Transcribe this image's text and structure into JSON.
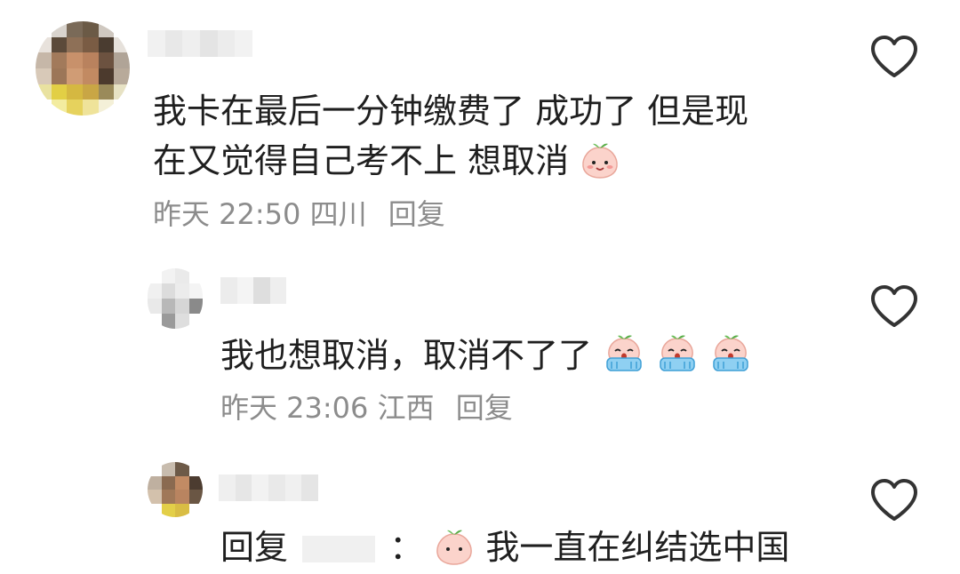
{
  "comments": [
    {
      "lines": [
        "我卡在最后一分钟缴费了 成功了 但是现",
        "在又觉得自己考不上 想取消"
      ],
      "meta": {
        "time": "昨天 22:50",
        "location": "四川",
        "reply": "回复"
      },
      "emoji": "peach-smile"
    },
    {
      "lines": [
        "我也想取消，取消不了了"
      ],
      "meta": {
        "time": "昨天 23:06",
        "location": "江西",
        "reply": "回复"
      },
      "emoji": "peach-cry"
    },
    {
      "lines": [
        "回复",
        "：",
        "我一直在纠结选中国"
      ],
      "emoji": "peach-smile"
    }
  ],
  "colors": {
    "text": "#1f1f1f",
    "meta": "#8c8c8c",
    "heart": "#333333"
  },
  "icons": {
    "like": "heart-outline-icon"
  }
}
